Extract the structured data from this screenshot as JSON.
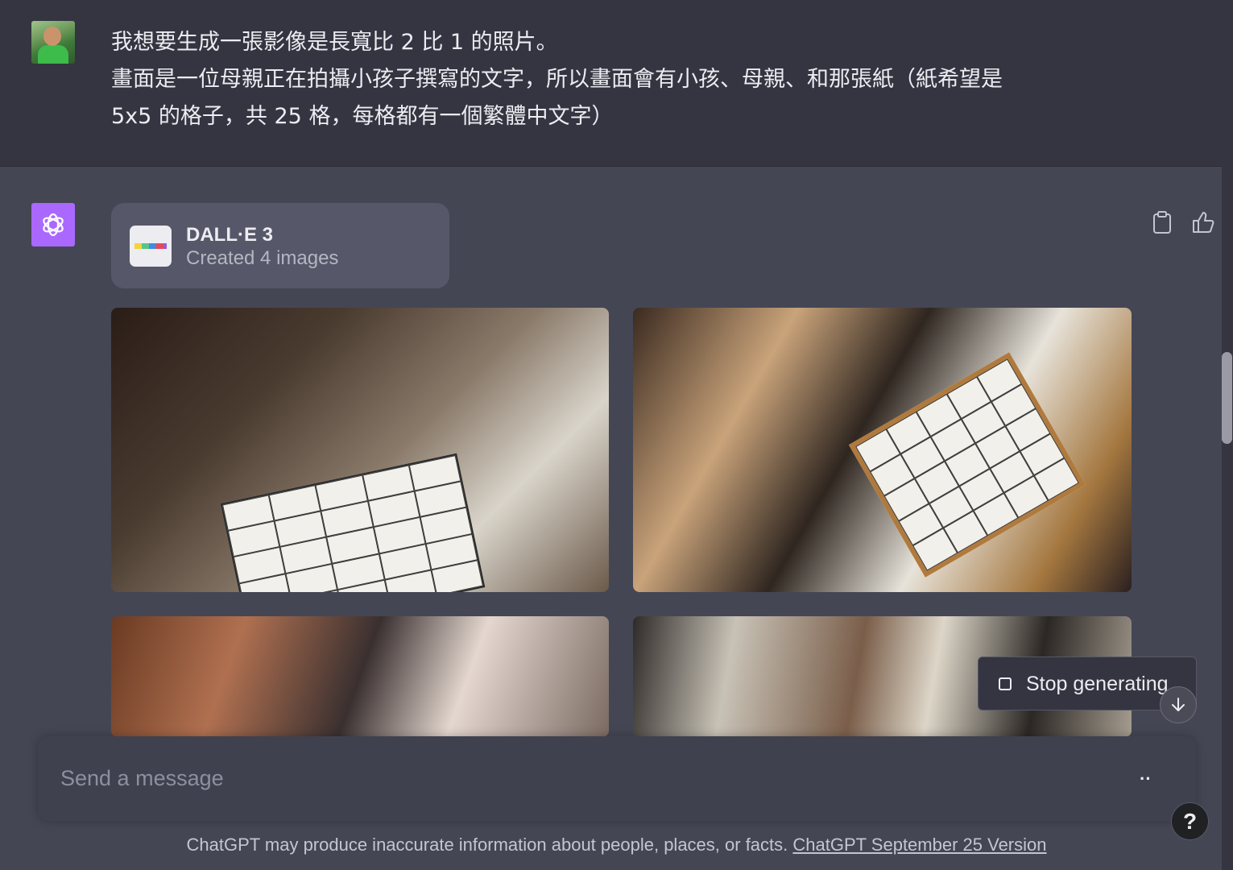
{
  "user_message": {
    "lines": [
      "我想要生成一張影像是長寬比 2 比 1 的照片。",
      "畫面是一位母親正在拍攝小孩子撰寫的文字，所以畫面會有小孩、母親、和那張紙（紙希望是",
      "5x5 的格子，共 25 格，每格都有一個繁體中文字）"
    ]
  },
  "assistant": {
    "tool_title": "DALL·E 3",
    "tool_subtitle": "Created 4 images"
  },
  "stop_button_label": "Stop generating",
  "input": {
    "placeholder": "Send a message",
    "value": ""
  },
  "footer": {
    "disclaimer": "ChatGPT may produce inaccurate information about people, places, or facts.",
    "version_link": "ChatGPT September 25 Version"
  },
  "help_label": "?",
  "colors": {
    "gpt_avatar": "#ab68ff",
    "background_user": "#343541",
    "background_assistant": "#444654"
  }
}
